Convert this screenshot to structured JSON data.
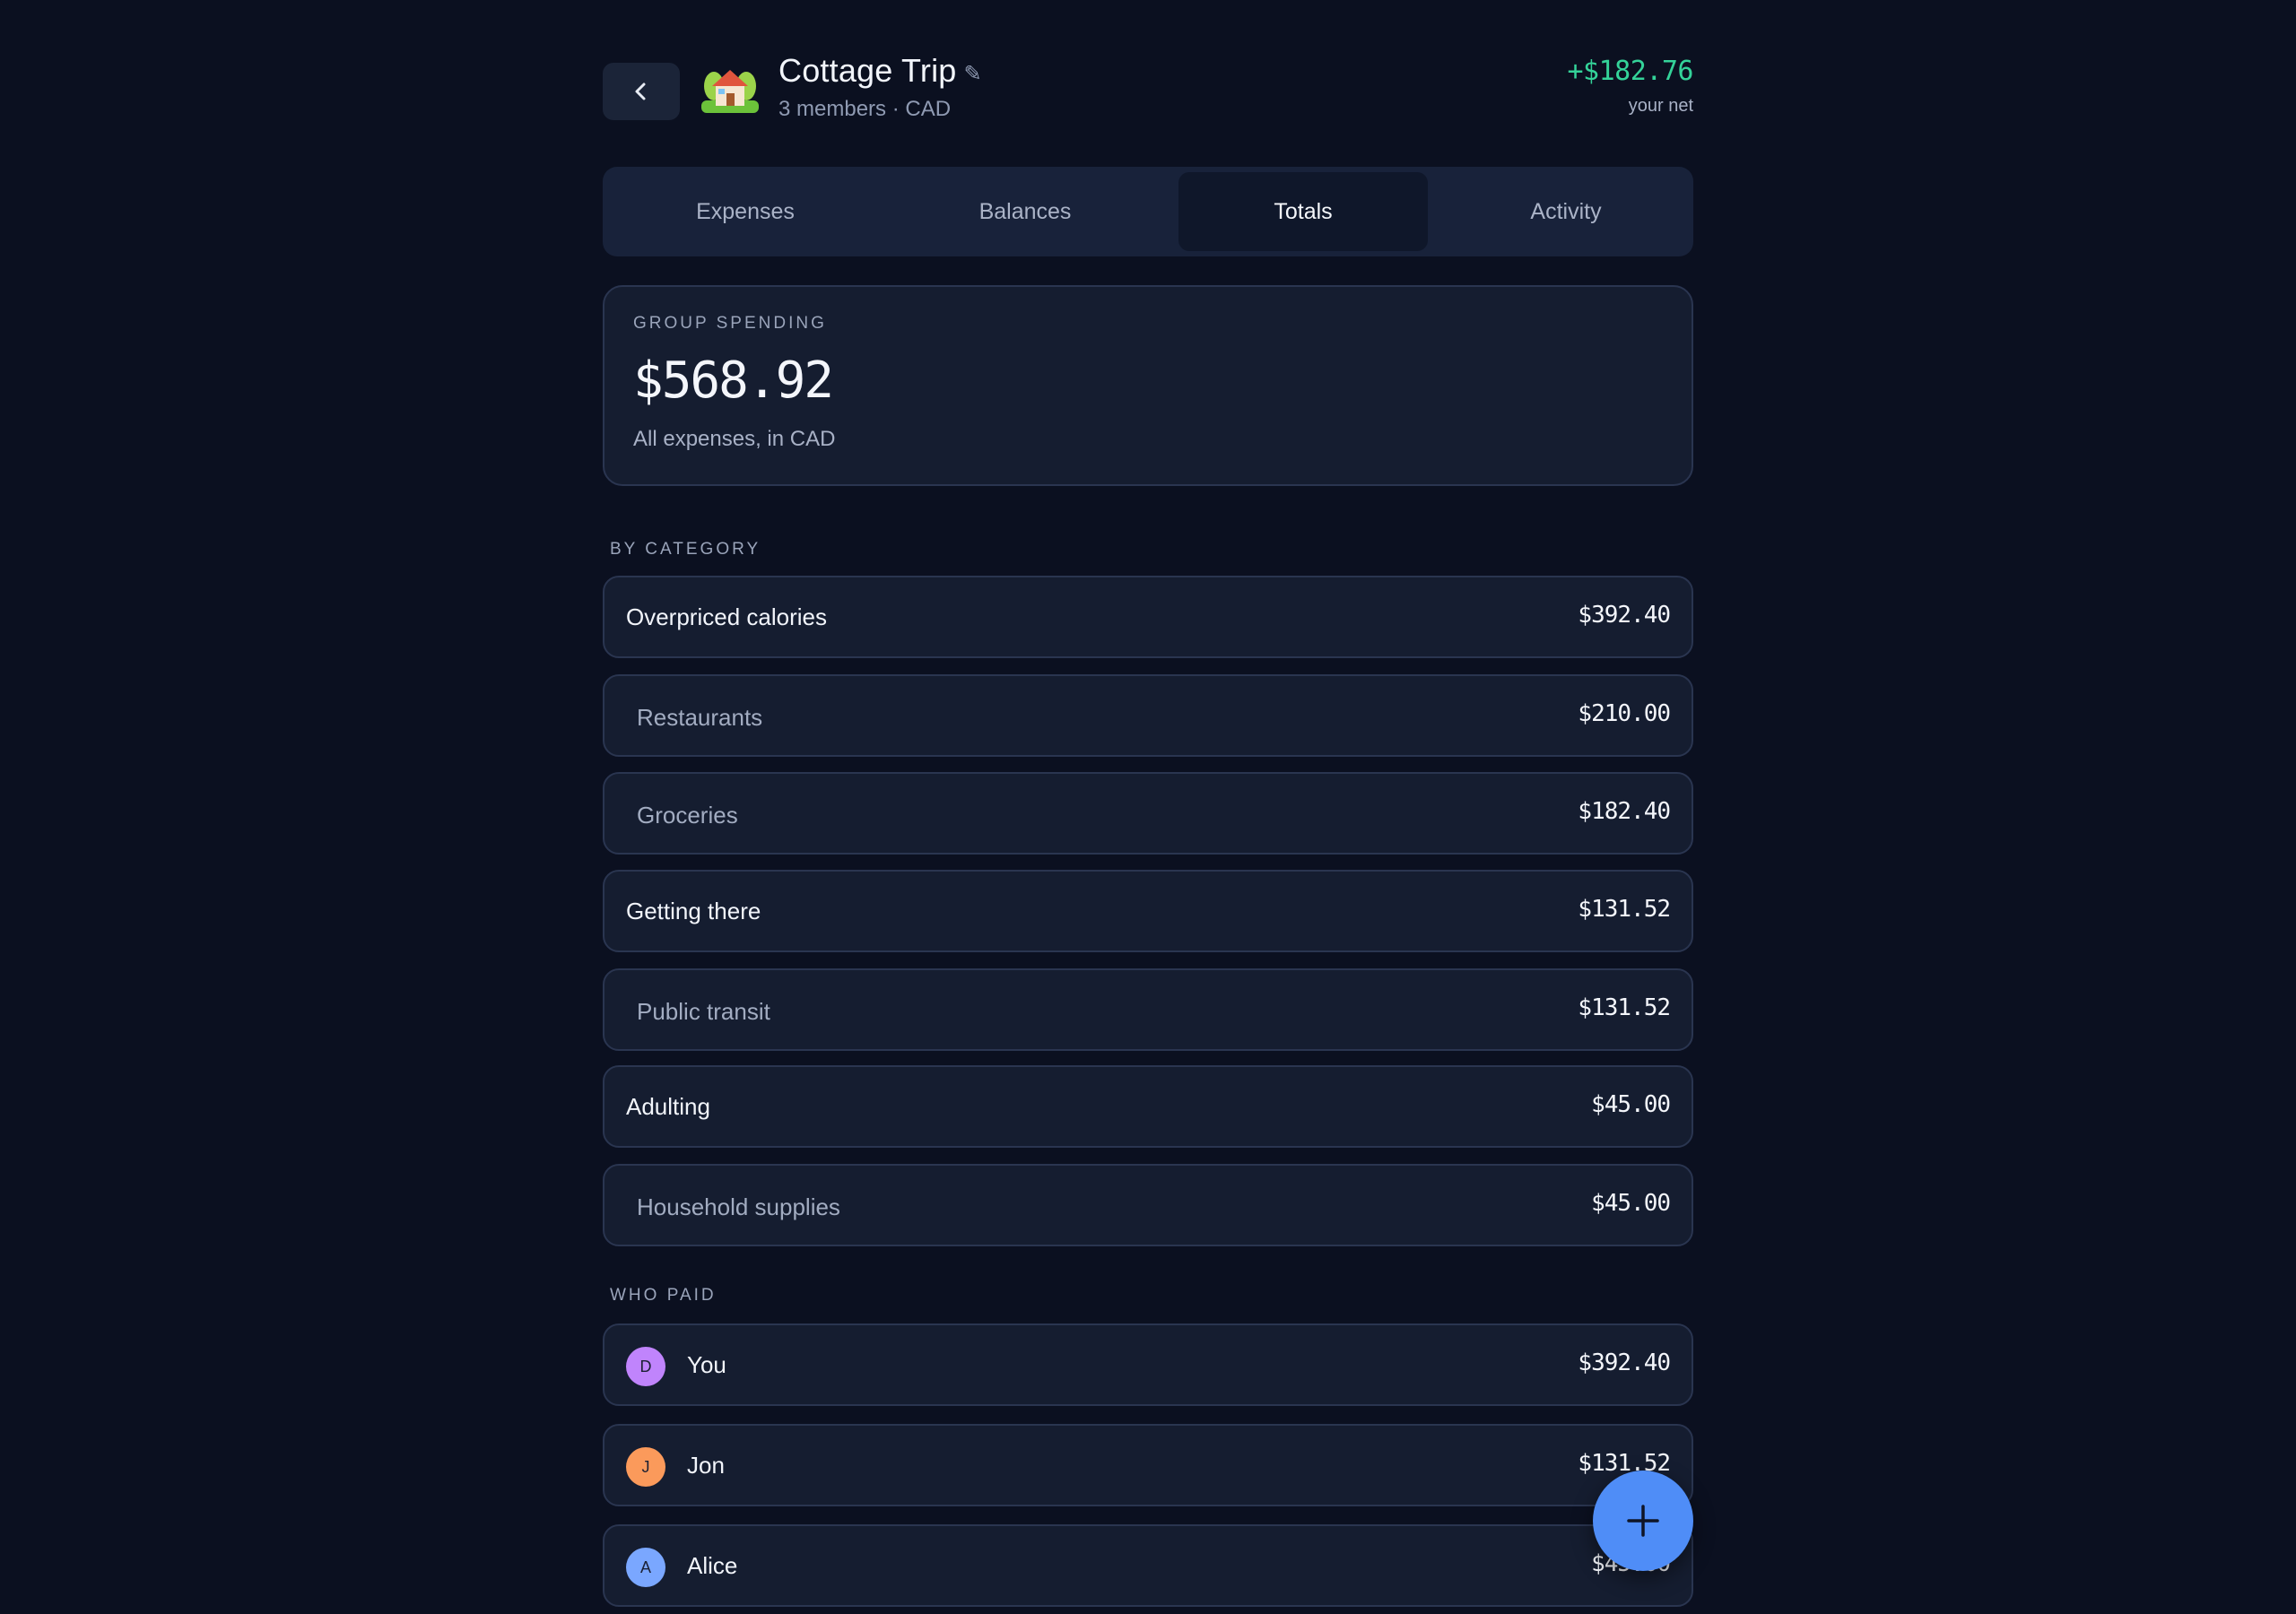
{
  "header": {
    "back_icon": "chevron-left-icon",
    "group_icon": "house-with-garden-icon",
    "title": "Cottage Trip",
    "edit_glyph": "✎",
    "subtitle": "3 members · CAD",
    "net_value": "+$182.76",
    "net_label": "your net",
    "net_color": "#34d399"
  },
  "tabs": [
    {
      "label": "Expenses",
      "active": false
    },
    {
      "label": "Balances",
      "active": false
    },
    {
      "label": "Totals",
      "active": true
    },
    {
      "label": "Activity",
      "active": false
    }
  ],
  "summary": {
    "label": "GROUP SPENDING",
    "amount": "$568.92",
    "note": "All expenses, in CAD"
  },
  "by_category": {
    "label": "BY CATEGORY",
    "rows": [
      {
        "label": "Overpriced calories",
        "amount": "$392.40",
        "kind": "parent"
      },
      {
        "label": "Restaurants",
        "amount": "$210.00",
        "kind": "sub"
      },
      {
        "label": "Groceries",
        "amount": "$182.40",
        "kind": "sub"
      },
      {
        "label": "Getting there",
        "amount": "$131.52",
        "kind": "parent"
      },
      {
        "label": "Public transit",
        "amount": "$131.52",
        "kind": "sub"
      },
      {
        "label": "Adulting",
        "amount": "$45.00",
        "kind": "parent"
      },
      {
        "label": "Household supplies",
        "amount": "$45.00",
        "kind": "sub"
      }
    ]
  },
  "who_paid": {
    "label": "WHO PAID",
    "rows": [
      {
        "initial": "D",
        "name": "You",
        "amount": "$392.40",
        "color": "#c084fc"
      },
      {
        "initial": "J",
        "name": "Jon",
        "amount": "$131.52",
        "color": "#fb9a5b"
      },
      {
        "initial": "A",
        "name": "Alice",
        "amount": "$45.00",
        "color": "#7aa7ff"
      }
    ]
  },
  "fab": {
    "icon": "plus-icon",
    "color": "#4f8df7"
  }
}
